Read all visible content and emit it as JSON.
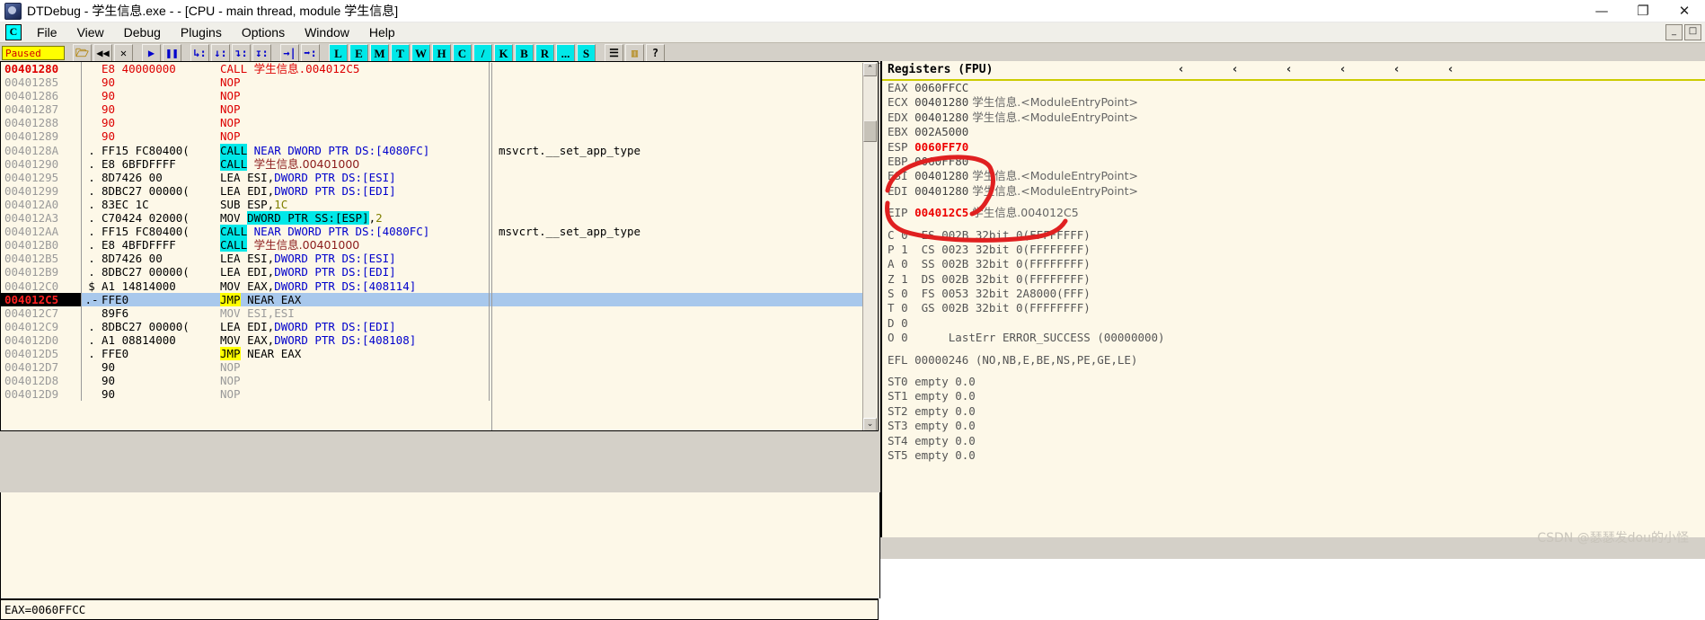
{
  "window": {
    "title": "DTDebug - 学生信息.exe - - [CPU - main thread, module 学生信息]",
    "app_icon": "debugger-icon",
    "minimize": "—",
    "maximize": "❐",
    "close": "✕"
  },
  "menu": {
    "app_badge": "C",
    "items": [
      {
        "label": "File"
      },
      {
        "label": "View"
      },
      {
        "label": "Debug"
      },
      {
        "label": "Plugins"
      },
      {
        "label": "Options"
      },
      {
        "label": "Window"
      },
      {
        "label": "Help"
      }
    ],
    "child_minimize": "_",
    "child_maximize": "□"
  },
  "toolbar": {
    "status": "Paused",
    "buttons": [
      {
        "name": "open-file-button",
        "glyph": "🗁",
        "style": "yel"
      },
      {
        "name": "restart-button",
        "glyph": "◀◀",
        "style": "blk"
      },
      {
        "name": "close-program-button",
        "glyph": "✕",
        "style": "blk"
      },
      {
        "name": "run-button",
        "glyph": "▶",
        "style": ""
      },
      {
        "name": "pause-button",
        "glyph": "❚❚",
        "style": ""
      },
      {
        "name": "step-into-button",
        "glyph": "↳:",
        "style": ""
      },
      {
        "name": "step-over-button",
        "glyph": "↓:",
        "style": ""
      },
      {
        "name": "trace-into-button",
        "glyph": "↴:",
        "style": ""
      },
      {
        "name": "trace-over-button",
        "glyph": "↧:",
        "style": ""
      },
      {
        "name": "execute-till-return-button",
        "glyph": "→|",
        "style": ""
      },
      {
        "name": "go-to-button",
        "glyph": "➡:",
        "style": ""
      },
      {
        "name": "log-window-button",
        "glyph": "L",
        "style": "cy"
      },
      {
        "name": "executable-modules-button",
        "glyph": "E",
        "style": "cy"
      },
      {
        "name": "memory-map-button",
        "glyph": "M",
        "style": "cy"
      },
      {
        "name": "threads-button",
        "glyph": "T",
        "style": "cy"
      },
      {
        "name": "windows-button",
        "glyph": "W",
        "style": "cy"
      },
      {
        "name": "handles-button",
        "glyph": "H",
        "style": "cy"
      },
      {
        "name": "cpu-button",
        "glyph": "C",
        "style": "cy"
      },
      {
        "name": "patches-button",
        "glyph": "/",
        "style": "cy"
      },
      {
        "name": "call-stack-button",
        "glyph": "K",
        "style": "cy"
      },
      {
        "name": "breakpoints-button",
        "glyph": "B",
        "style": "cy"
      },
      {
        "name": "references-button",
        "glyph": "R",
        "style": "cy"
      },
      {
        "name": "run-trace-button",
        "glyph": "...",
        "style": "cy"
      },
      {
        "name": "source-button",
        "glyph": "S",
        "style": "cy"
      },
      {
        "name": "options-list-button",
        "glyph": "☰",
        "style": "blk"
      },
      {
        "name": "appearance-button",
        "glyph": "▥",
        "style": "yel"
      },
      {
        "name": "help-button",
        "glyph": "?",
        "style": "blk"
      }
    ]
  },
  "disassembly": {
    "rows": [
      {
        "addr": "00401280",
        "addr_style": "red",
        "mark": "",
        "hex": "E8 40000000",
        "hex_style": "red",
        "dis": [
          {
            "t": "CALL ",
            "s": "red"
          },
          {
            "t": "学生信息",
            "s": "cjk-red"
          },
          {
            "t": ".004012C5",
            "s": "red"
          }
        ],
        "comment": ""
      },
      {
        "addr": "00401285",
        "addr_style": "",
        "mark": "",
        "hex": "90",
        "hex_style": "red",
        "dis": [
          {
            "t": "NOP",
            "s": "red"
          }
        ],
        "comment": ""
      },
      {
        "addr": "00401286",
        "addr_style": "",
        "mark": "",
        "hex": "90",
        "hex_style": "red",
        "dis": [
          {
            "t": "NOP",
            "s": "red"
          }
        ],
        "comment": ""
      },
      {
        "addr": "00401287",
        "addr_style": "",
        "mark": "",
        "hex": "90",
        "hex_style": "red",
        "dis": [
          {
            "t": "NOP",
            "s": "red"
          }
        ],
        "comment": ""
      },
      {
        "addr": "00401288",
        "addr_style": "",
        "mark": "",
        "hex": "90",
        "hex_style": "red",
        "dis": [
          {
            "t": "NOP",
            "s": "red"
          }
        ],
        "comment": ""
      },
      {
        "addr": "00401289",
        "addr_style": "",
        "mark": "",
        "hex": "90",
        "hex_style": "red",
        "dis": [
          {
            "t": "NOP",
            "s": "red"
          }
        ],
        "comment": ""
      },
      {
        "addr": "0040128A",
        "addr_style": "",
        "mark": ".",
        "hex": "FF15 FC80400(",
        "hex_style": "",
        "dis": [
          {
            "t": "CALL",
            "s": "cyan"
          },
          {
            "t": " ",
            "s": ""
          },
          {
            "t": "NEAR DWORD PTR DS:[4080FC]",
            "s": "blue"
          }
        ],
        "comment": "msvcrt.__set_app_type"
      },
      {
        "addr": "00401290",
        "addr_style": "",
        "mark": ".",
        "hex": "E8 6BFDFFFF",
        "hex_style": "",
        "dis": [
          {
            "t": "CALL",
            "s": "cyan"
          },
          {
            "t": " ",
            "s": ""
          },
          {
            "t": "学生信息",
            "s": "cjk-dark"
          },
          {
            "t": ".00401000",
            "s": "dark"
          }
        ],
        "comment": ""
      },
      {
        "addr": "00401295",
        "addr_style": "",
        "mark": ".",
        "hex": "8D7426 00",
        "hex_style": "",
        "dis": [
          {
            "t": "LEA ESI,",
            "s": ""
          },
          {
            "t": "DWORD PTR DS:[ESI]",
            "s": "blue"
          }
        ],
        "comment": ""
      },
      {
        "addr": "00401299",
        "addr_style": "",
        "mark": ".",
        "hex": "8DBC27 00000(",
        "hex_style": "",
        "dis": [
          {
            "t": "LEA EDI,",
            "s": ""
          },
          {
            "t": "DWORD PTR DS:[EDI]",
            "s": "blue"
          }
        ],
        "comment": ""
      },
      {
        "addr": "004012A0",
        "addr_style": "",
        "mark": ".",
        "hex": "83EC 1C",
        "hex_style": "",
        "dis": [
          {
            "t": "SUB ESP,",
            "s": ""
          },
          {
            "t": "1C",
            "s": "olive"
          }
        ],
        "comment": ""
      },
      {
        "addr": "004012A3",
        "addr_style": "",
        "mark": ".",
        "hex": "C70424 02000(",
        "hex_style": "",
        "dis": [
          {
            "t": "MOV ",
            "s": ""
          },
          {
            "t": "DWORD PTR SS:[ESP]",
            "s": "cyan-blue"
          },
          {
            "t": ",",
            "s": ""
          },
          {
            "t": "2",
            "s": "olive"
          }
        ],
        "comment": ""
      },
      {
        "addr": "004012AA",
        "addr_style": "",
        "mark": ".",
        "hex": "FF15 FC80400(",
        "hex_style": "",
        "dis": [
          {
            "t": "CALL",
            "s": "cyan"
          },
          {
            "t": " ",
            "s": ""
          },
          {
            "t": "NEAR DWORD PTR DS:[4080FC]",
            "s": "blue"
          }
        ],
        "comment": "msvcrt.__set_app_type"
      },
      {
        "addr": "004012B0",
        "addr_style": "",
        "mark": ".",
        "hex": "E8 4BFDFFFF",
        "hex_style": "",
        "dis": [
          {
            "t": "CALL",
            "s": "cyan"
          },
          {
            "t": " ",
            "s": ""
          },
          {
            "t": "学生信息",
            "s": "cjk-dark"
          },
          {
            "t": ".00401000",
            "s": "dark"
          }
        ],
        "comment": ""
      },
      {
        "addr": "004012B5",
        "addr_style": "",
        "mark": ".",
        "hex": "8D7426 00",
        "hex_style": "",
        "dis": [
          {
            "t": "LEA ESI,",
            "s": ""
          },
          {
            "t": "DWORD PTR DS:[ESI]",
            "s": "blue"
          }
        ],
        "comment": ""
      },
      {
        "addr": "004012B9",
        "addr_style": "",
        "mark": ".",
        "hex": "8DBC27 00000(",
        "hex_style": "",
        "dis": [
          {
            "t": "LEA EDI,",
            "s": ""
          },
          {
            "t": "DWORD PTR DS:[EDI]",
            "s": "blue"
          }
        ],
        "comment": ""
      },
      {
        "addr": "004012C0",
        "addr_style": "",
        "mark": "$",
        "hex": "A1 14814000",
        "hex_style": "",
        "dis": [
          {
            "t": "MOV EAX,",
            "s": ""
          },
          {
            "t": "DWORD PTR DS:[408114]",
            "s": "blue"
          }
        ],
        "comment": ""
      },
      {
        "addr": "004012C5",
        "addr_style": "hot",
        "mark": ".-",
        "hex": "FFE0",
        "hex_style": "",
        "selected": true,
        "dis": [
          {
            "t": "JMP",
            "s": "yel"
          },
          {
            "t": " NEAR EAX",
            "s": ""
          }
        ],
        "comment": ""
      },
      {
        "addr": "004012C7",
        "addr_style": "",
        "mark": "",
        "hex": "89F6",
        "hex_style": "",
        "dis": [
          {
            "t": "MOV ESI,ESI",
            "s": "grey"
          }
        ],
        "comment": ""
      },
      {
        "addr": "004012C9",
        "addr_style": "",
        "mark": ".",
        "hex": "8DBC27 00000(",
        "hex_style": "",
        "dis": [
          {
            "t": "LEA EDI,",
            "s": ""
          },
          {
            "t": "DWORD PTR DS:[EDI]",
            "s": "blue"
          }
        ],
        "comment": ""
      },
      {
        "addr": "004012D0",
        "addr_style": "",
        "mark": ".",
        "hex": "A1 08814000",
        "hex_style": "",
        "dis": [
          {
            "t": "MOV EAX,",
            "s": ""
          },
          {
            "t": "DWORD PTR DS:[408108]",
            "s": "blue"
          }
        ],
        "comment": ""
      },
      {
        "addr": "004012D5",
        "addr_style": "",
        "mark": ".",
        "hex": "FFE0",
        "hex_style": "",
        "dis": [
          {
            "t": "JMP",
            "s": "yel"
          },
          {
            "t": " NEAR EAX",
            "s": ""
          }
        ],
        "comment": ""
      },
      {
        "addr": "004012D7",
        "addr_style": "",
        "mark": "",
        "hex": "90",
        "hex_style": "",
        "dis": [
          {
            "t": "NOP",
            "s": "grey"
          }
        ],
        "comment": ""
      },
      {
        "addr": "004012D8",
        "addr_style": "",
        "mark": "",
        "hex": "90",
        "hex_style": "",
        "dis": [
          {
            "t": "NOP",
            "s": "grey"
          }
        ],
        "comment": ""
      },
      {
        "addr": "004012D9",
        "addr_style": "",
        "mark": "",
        "hex": "90",
        "hex_style": "",
        "dis": [
          {
            "t": "NOP",
            "s": "grey"
          }
        ],
        "comment": ""
      }
    ],
    "scroll_up_arrow": "⌃",
    "scroll_down_arrow": "⌄"
  },
  "registers": {
    "title": "Registers (FPU)",
    "chevrons": [
      "‹",
      "‹",
      "‹",
      "‹",
      "‹",
      "‹"
    ],
    "lines": [
      {
        "name": "EAX",
        "value": "0060FFCC",
        "value_style": "",
        "note": ""
      },
      {
        "name": "ECX",
        "value": "00401280",
        "value_style": "",
        "note": "学生信息.<ModuleEntryPoint>"
      },
      {
        "name": "EDX",
        "value": "00401280",
        "value_style": "",
        "note": "学生信息.<ModuleEntryPoint>"
      },
      {
        "name": "EBX",
        "value": "002A5000",
        "value_style": "",
        "note": ""
      },
      {
        "name": "ESP",
        "value": "0060FF70",
        "value_style": "red",
        "note": ""
      },
      {
        "name": "EBP",
        "value": "0060FF80",
        "value_style": "",
        "note": ""
      },
      {
        "name": "ESI",
        "value": "00401280",
        "value_style": "",
        "note": "学生信息.<ModuleEntryPoint>"
      },
      {
        "name": "EDI",
        "value": "00401280",
        "value_style": "",
        "note": "学生信息.<ModuleEntryPoint>"
      },
      {
        "gap": true
      },
      {
        "name": "EIP",
        "value": "004012C5",
        "value_style": "red",
        "note": "学生信息.004012C5"
      },
      {
        "gap": true
      }
    ],
    "flags": [
      {
        "flag": "C",
        "bit": "0",
        "seg": "ES",
        "selv": "002B",
        "desc": "32bit 0(FFFFFFFF)"
      },
      {
        "flag": "P",
        "bit": "1",
        "seg": "CS",
        "selv": "0023",
        "desc": "32bit 0(FFFFFFFF)"
      },
      {
        "flag": "A",
        "bit": "0",
        "seg": "SS",
        "selv": "002B",
        "desc": "32bit 0(FFFFFFFF)"
      },
      {
        "flag": "Z",
        "bit": "1",
        "seg": "DS",
        "selv": "002B",
        "desc": "32bit 0(FFFFFFFF)"
      },
      {
        "flag": "S",
        "bit": "0",
        "seg": "FS",
        "selv": "0053",
        "desc": "32bit 2A8000(FFF)"
      },
      {
        "flag": "T",
        "bit": "0",
        "seg": "GS",
        "selv": "002B",
        "desc": "32bit 0(FFFFFFFF)"
      },
      {
        "flag": "D",
        "bit": "0",
        "seg": "",
        "selv": "",
        "desc": ""
      },
      {
        "flag": "O",
        "bit": "0",
        "seg": "",
        "selv": "",
        "desc": "LastErr ERROR_SUCCESS (00000000)"
      }
    ],
    "efl": "EFL 00000246 (NO,NB,E,BE,NS,PE,GE,LE)",
    "fpu": [
      "ST0 empty 0.0",
      "ST1 empty 0.0",
      "ST2 empty 0.0",
      "ST3 empty 0.0",
      "ST4 empty 0.0",
      "ST5 empty 0.0"
    ]
  },
  "status_bar": {
    "text": "EAX=0060FFCC"
  },
  "annotations": {
    "color": "#e02020",
    "marks": [
      "esp-circle-annotation",
      "eip-underline-annotation"
    ]
  },
  "watermark": {
    "text": "CSDN @瑟瑟发dou的小怪"
  }
}
